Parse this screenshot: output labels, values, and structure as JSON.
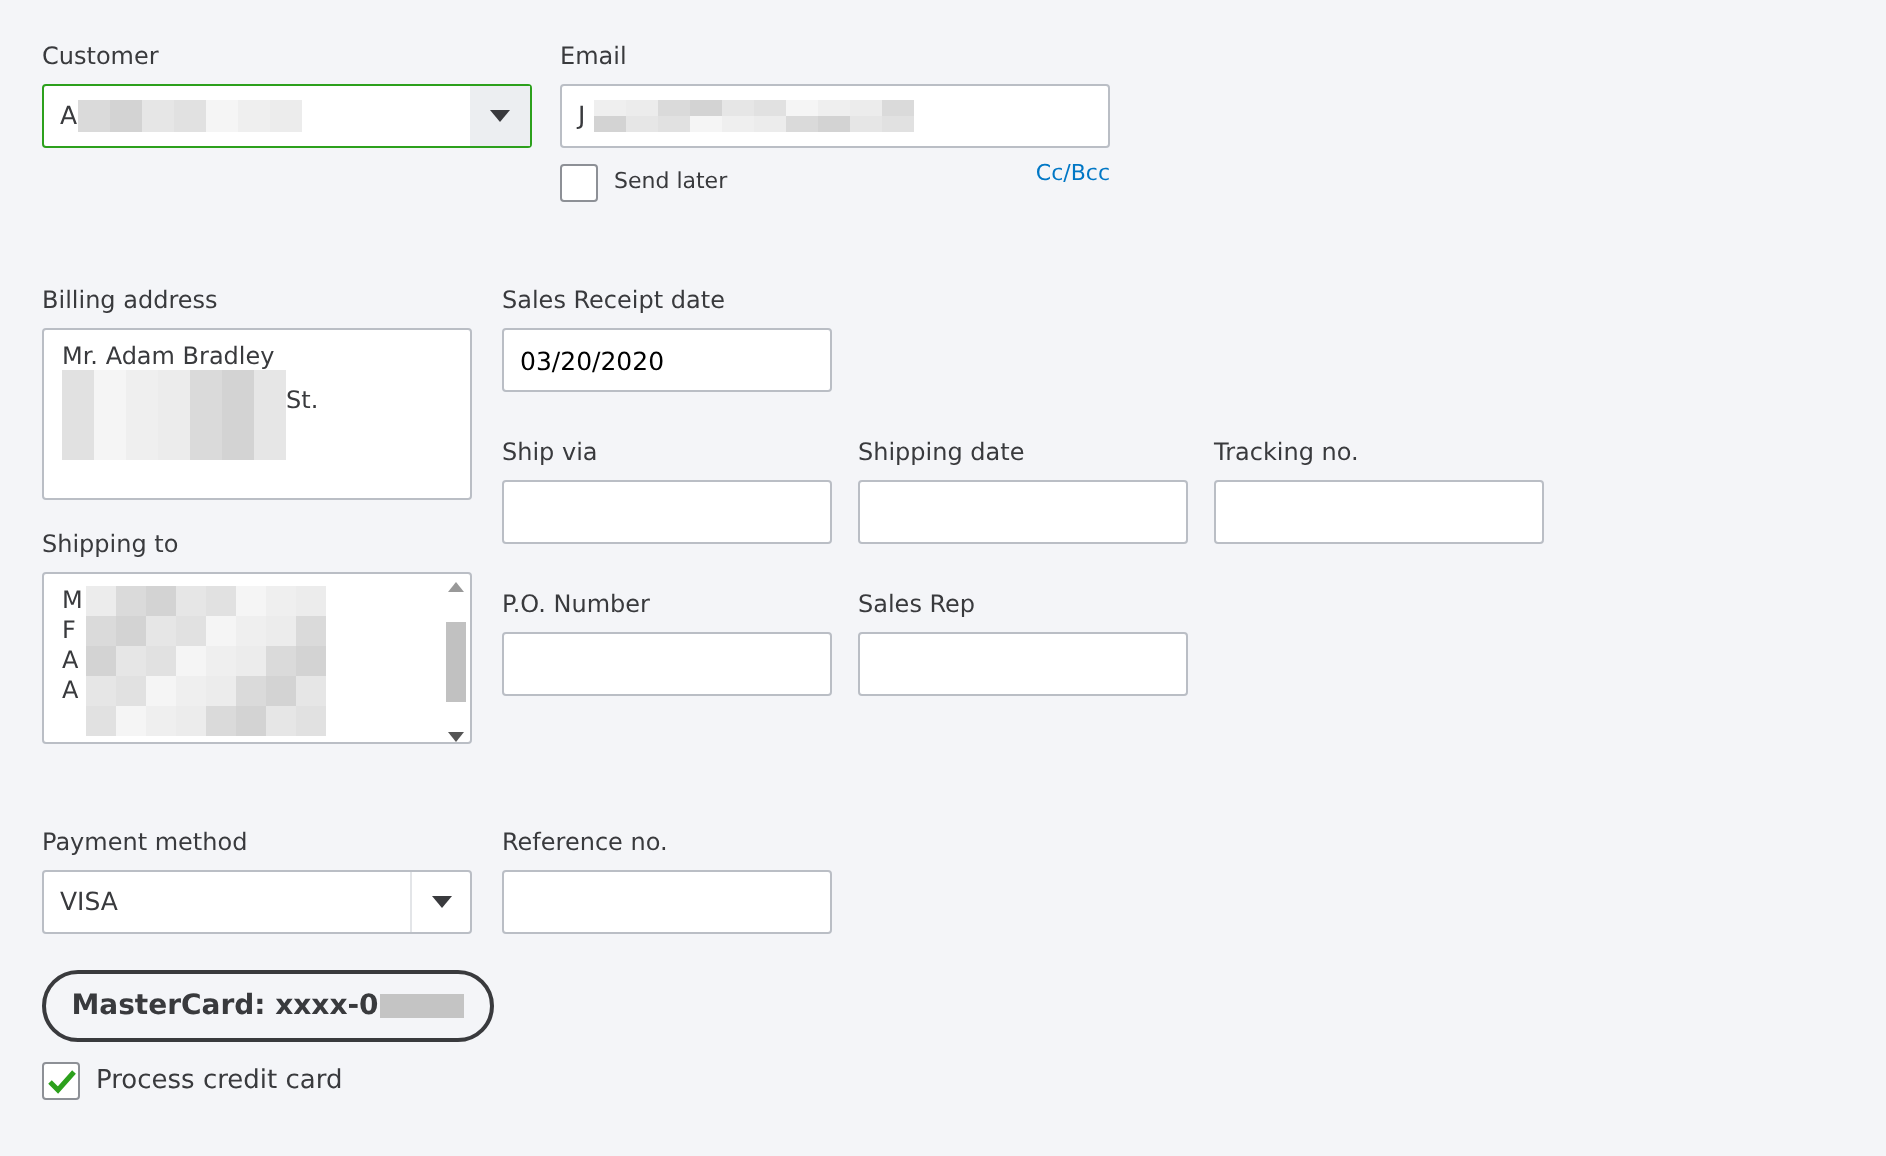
{
  "customer": {
    "label": "Customer",
    "value": "A",
    "focused": true
  },
  "email": {
    "label": "Email",
    "value": "J",
    "focused": false
  },
  "send_later": {
    "label": "Send later",
    "checked": false
  },
  "cc_bcc": "Cc/Bcc",
  "billing_address": {
    "label": "Billing address",
    "first_line": "Mr. Adam Bradley",
    "line_end": "St."
  },
  "shipping_to": {
    "label": "Shipping to",
    "initials": [
      "M",
      "F",
      "A",
      "A"
    ]
  },
  "fields": [
    {
      "label": "Sales Receipt date",
      "value": "03/20/2020"
    },
    {
      "label": "Ship via"
    },
    {
      "label": "Shipping date"
    },
    {
      "label": "Tracking no."
    },
    {
      "label": "P.O. Number"
    },
    {
      "label": "Sales Rep"
    }
  ],
  "payment_method": {
    "label": "Payment method",
    "value": "VISA"
  },
  "reference_no": {
    "label": "Reference no."
  },
  "card": {
    "text": "MasterCard: xxxx-0"
  },
  "process_card": {
    "label": "Process credit card",
    "checked": true
  }
}
